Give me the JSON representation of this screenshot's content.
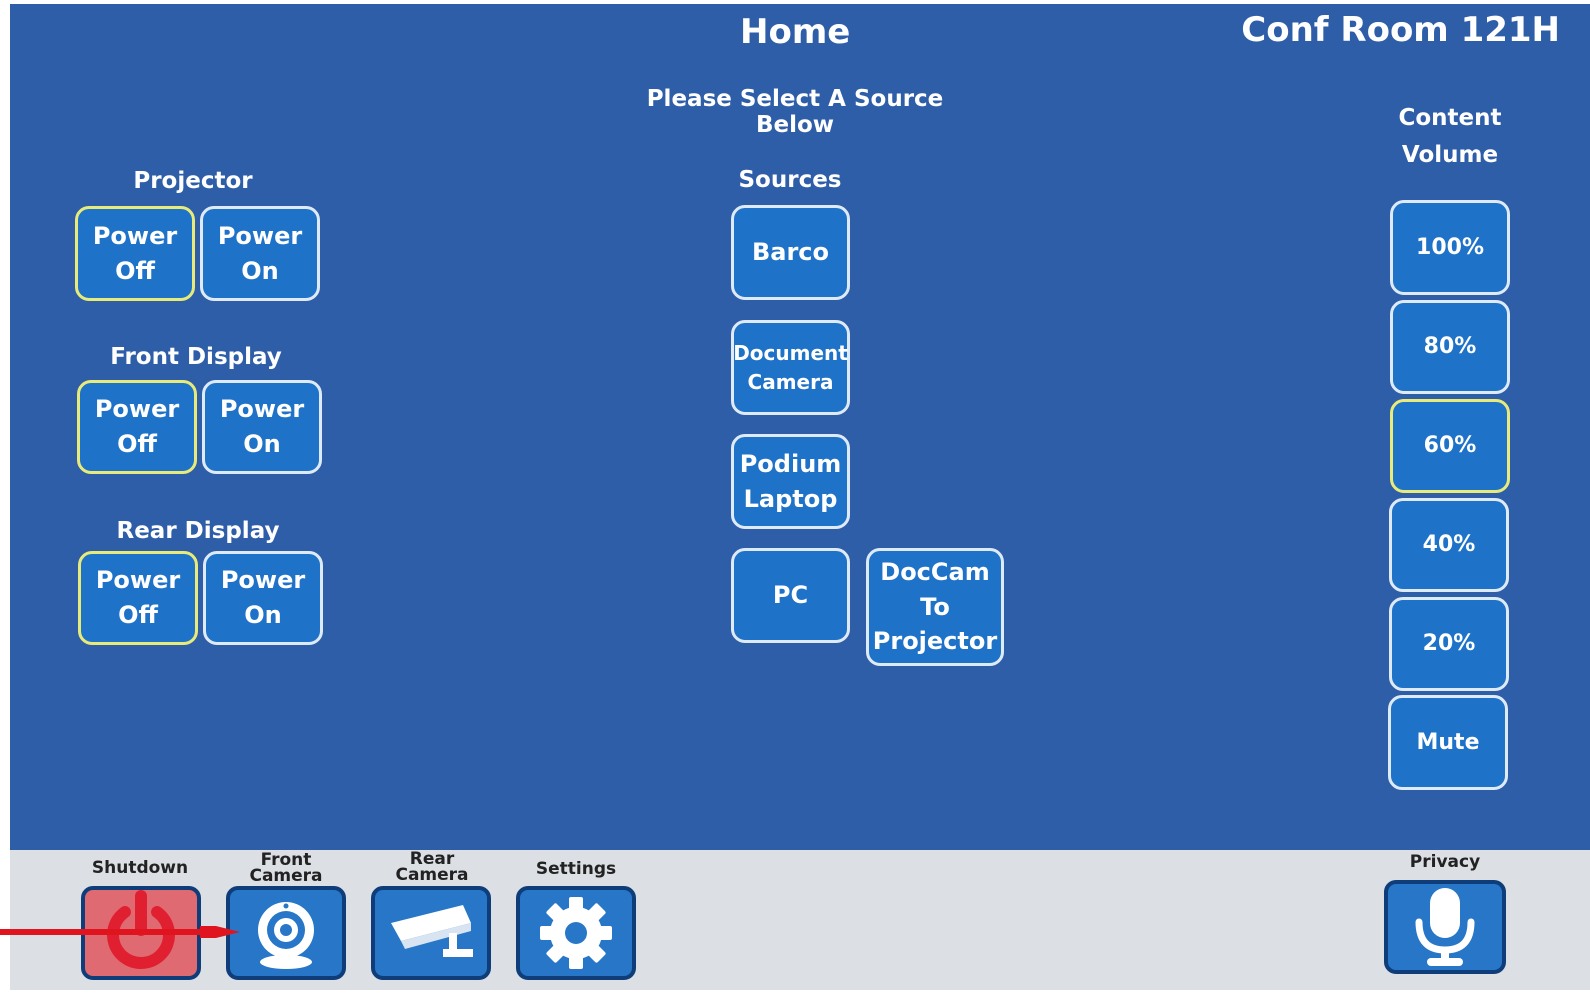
{
  "header": {
    "title": "Home",
    "room": "Conf Room 121H",
    "subtitle": "Please Select A Source Below"
  },
  "displays": [
    {
      "label": "Projector",
      "off": "Power\nOff",
      "on": "Power\nOn",
      "active": "off"
    },
    {
      "label": "Front Display",
      "off": "Power\nOff",
      "on": "Power\nOn",
      "active": "off"
    },
    {
      "label": "Rear Display",
      "off": "Power\nOff",
      "on": "Power\nOn",
      "active": "off"
    }
  ],
  "sources": {
    "label": "Sources",
    "items": [
      "Barco",
      "Document\nCamera",
      "Podium\nLaptop",
      "PC",
      "DocCam\nTo\nProjector"
    ]
  },
  "volume": {
    "label": "Content\nVolume",
    "levels": [
      "100%",
      "80%",
      "60%",
      "40%",
      "20%",
      "Mute"
    ],
    "selected": "60%"
  },
  "bottom": {
    "shutdown": "Shutdown",
    "front_camera": "Front\nCamera",
    "rear_camera": "Rear\nCamera",
    "settings": "Settings",
    "privacy": "Privacy"
  },
  "colors": {
    "background": "#2f5ea8",
    "button": "#1e72c8",
    "active_border": "#e8ea7a",
    "annotation_arrow": "#e0141e"
  }
}
